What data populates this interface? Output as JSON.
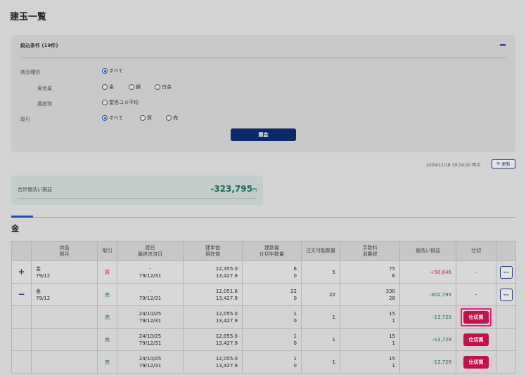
{
  "page": {
    "title": "建玉一覧"
  },
  "filter": {
    "header": "絞込条件 (19件)",
    "product_type_label": "商品種別",
    "product_all": "すべて",
    "precious_label": "貴金属",
    "precious_options": [
      "金",
      "銀",
      "白金"
    ],
    "agri_label": "農産物",
    "agri_options": [
      "堂島コメ平均"
    ],
    "trade_label": "取引",
    "trade_options": [
      "すべて",
      "買",
      "売"
    ],
    "query_button": "照会"
  },
  "timestamp": "2024/11/18 19:14:20 時点",
  "refresh_label": "更新",
  "summary": {
    "label": "合計値洗い損益",
    "value": "-323,795",
    "unit": "円"
  },
  "section_title": "金",
  "table": {
    "headers": {
      "product": [
        "商品",
        "限月"
      ],
      "trade": "取引",
      "date": [
        "建日",
        "最終決済日"
      ],
      "price": [
        "建単価",
        "現在値"
      ],
      "qty": [
        "建数量",
        "仕切中数量"
      ],
      "orderable": "注文可能数量",
      "fee": [
        "手数料",
        "消費税"
      ],
      "pl": "値洗い損益",
      "settle": "仕切"
    },
    "rows": [
      {
        "product": "金",
        "month": "79/12",
        "trade": "買",
        "date1": "-",
        "date2": "79/12/31",
        "price1": "12,355.0",
        "price2": "13,427.9",
        "qty1": "6",
        "qty2": "0",
        "orderable": "5",
        "fee1": "75",
        "fee2": "6",
        "pl": "+50,646",
        "settle": "-"
      },
      {
        "product": "金",
        "month": "79/12",
        "trade": "売",
        "date1": "-",
        "date2": "79/12/31",
        "price1": "12,051.6",
        "price2": "13,427.9",
        "qty1": "22",
        "qty2": "0",
        "orderable": "22",
        "fee1": "330",
        "fee2": "28",
        "pl": "-302,793",
        "settle": "-"
      }
    ],
    "sub_rows": [
      {
        "trade": "売",
        "date1": "24/10/25",
        "date2": "79/12/31",
        "price1": "12,055.0",
        "price2": "13,427.9",
        "qty1": "1",
        "qty2": "0",
        "orderable": "1",
        "fee1": "15",
        "fee2": "1",
        "pl": "-13,729",
        "settle": "仕切買"
      },
      {
        "trade": "売",
        "date1": "24/10/25",
        "date2": "79/12/31",
        "price1": "12,055.0",
        "price2": "13,427.9",
        "qty1": "1",
        "qty2": "0",
        "orderable": "1",
        "fee1": "15",
        "fee2": "1",
        "pl": "-13,729",
        "settle": "仕切買"
      },
      {
        "trade": "売",
        "date1": "24/10/25",
        "date2": "79/12/31",
        "price1": "12,055.0",
        "price2": "13,427.9",
        "qty1": "1",
        "qty2": "0",
        "orderable": "1",
        "fee1": "15",
        "fee2": "1",
        "pl": "-13,729",
        "settle": "仕切買"
      }
    ],
    "expand_icons": [
      "+",
      "−"
    ],
    "chart_icon": "chart-icon"
  }
}
